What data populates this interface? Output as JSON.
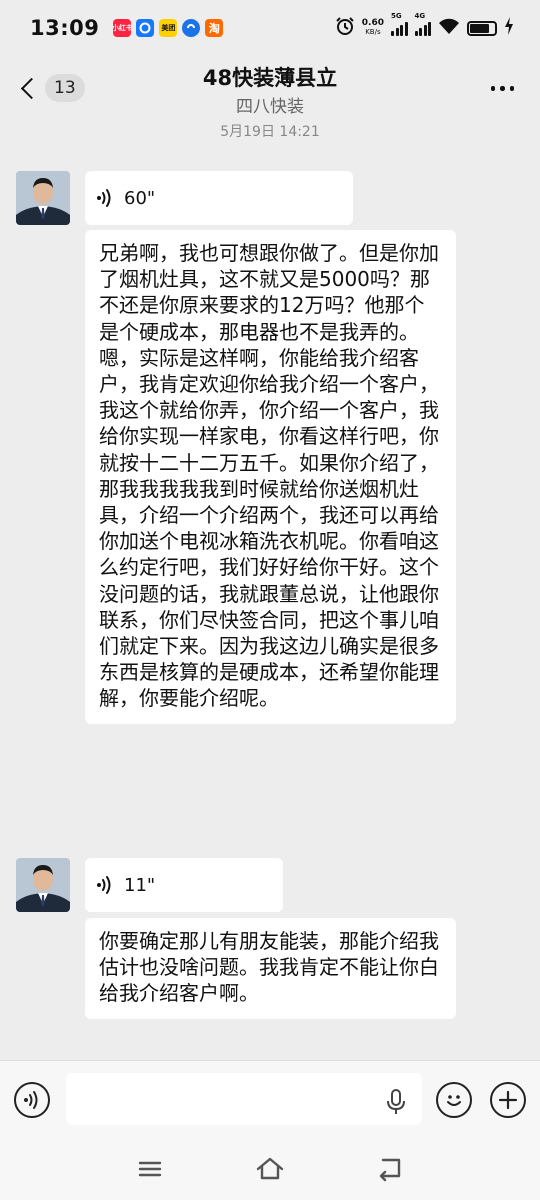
{
  "status_bar": {
    "time": "13:09",
    "apps": [
      {
        "name": "app-red",
        "label": "小红书",
        "color": "#ff2442"
      },
      {
        "name": "app-blue",
        "label": "",
        "color": "#1677ff"
      },
      {
        "name": "app-meituan",
        "label": "美团",
        "color": "#ffd100"
      },
      {
        "name": "app-fund",
        "label": "",
        "color": "#1a73e8"
      },
      {
        "name": "app-taobao",
        "label": "淘",
        "color": "#ff6a00"
      }
    ],
    "net_speed": "0.60",
    "net_speed_unit": "KB/s",
    "signal1_label": "5G",
    "signal2_label": "4G"
  },
  "header": {
    "unread_count": "13",
    "title": "48快装薄县立",
    "subtitle": "四八快装"
  },
  "timestamp": "5月19日 14:21",
  "messages": [
    {
      "voice_duration": "60\"",
      "transcript": "兄弟啊，我也可想跟你做了。但是你加了烟机灶具，这不就又是5000吗？那不还是你原来要求的12万吗？他那个是个硬成本，那电器也不是我弄的。嗯，实际是这样啊，你能给我介绍客户，我肯定欢迎你给我介绍一个客户，我这个就给你弄，你介绍一个客户，我给你实现一样家电，你看这样行吧，你就按十二十二万五千。如果你介绍了，那我我我我我到时候就给你送烟机灶具，介绍一个介绍两个，我还可以再给你加送个电视冰箱洗衣机呢。你看咱这么约定行吧，我们好好给你干好。这个没问题的话，我就跟董总说，让他跟你联系，你们尽快签合同，把这个事儿咱们就定下来。因为我这边儿确实是很多东西是核算的是硬成本，还希望你能理解，你要能介绍呢。"
    },
    {
      "voice_duration": "11\"",
      "transcript": "你要确定那儿有朋友能装，那能介绍我估计也没啥问题。我我肯定不能让你白给我介绍客户啊。"
    }
  ],
  "input_bar": {
    "placeholder": ""
  },
  "colors": {
    "background": "#ededed",
    "bubble": "#ffffff",
    "text": "#111111",
    "muted": "#888888"
  }
}
